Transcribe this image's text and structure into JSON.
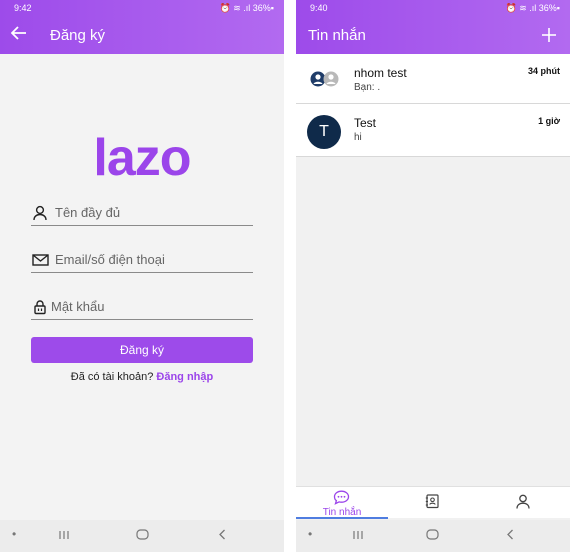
{
  "left": {
    "status": {
      "time": "9:42",
      "right": "⏰ ≋ .ıl 36%▪"
    },
    "header": {
      "title": "Đăng ký",
      "back_icon": "arrow-left-icon"
    },
    "logo": "lazo",
    "fields": {
      "fullname_placeholder": "Tên đầy đủ",
      "email_placeholder": "Email/số điện thoại",
      "password_placeholder": "Mật khẩu"
    },
    "register_button": "Đăng ký",
    "login_prompt": "Đã có tài khoản?",
    "login_link": "Đăng nhập",
    "colors": {
      "accent": "#9d4bea"
    }
  },
  "right": {
    "status": {
      "time": "9:40",
      "right": "⏰ ≋ .ıl 36%▪"
    },
    "header": {
      "title": "Tin nhắn",
      "add_icon": "plus-icon"
    },
    "conversations": [
      {
        "name": "nhom test",
        "preview": "Bạn: .",
        "time": "34 phút",
        "avatar": "group-avatar-icon"
      },
      {
        "name": "Test",
        "preview": "hi",
        "time": "1 giờ",
        "avatar_letter": "T"
      }
    ],
    "tabs": [
      {
        "label": "Tin nhắn",
        "icon": "chat-bubble-icon",
        "active": true
      },
      {
        "label": "",
        "icon": "contacts-book-icon",
        "active": false
      },
      {
        "label": "",
        "icon": "user-icon",
        "active": false
      }
    ]
  }
}
